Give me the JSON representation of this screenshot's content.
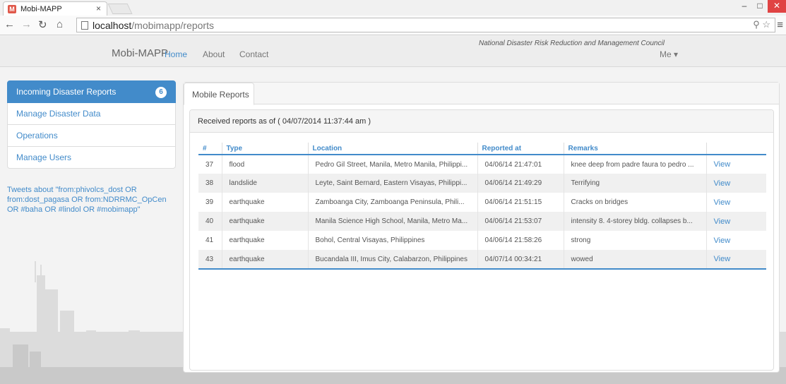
{
  "browser": {
    "tab_title": "Mobi-MAPP",
    "tab_close": "×",
    "url_host": "localhost",
    "url_path": "/mobimapp/reports"
  },
  "navbar": {
    "brand": "Mobi-MAPP",
    "links": [
      "Home",
      "About",
      "Contact"
    ],
    "council": "National Disaster Risk Reduction and Management Council",
    "user_menu": "Me ▾"
  },
  "sidebar": {
    "items": [
      {
        "label": "Incoming Disaster Reports",
        "badge": "6"
      },
      {
        "label": "Manage Disaster Data"
      },
      {
        "label": "Operations"
      },
      {
        "label": "Manage Users"
      }
    ],
    "tweets": "Tweets about \"from:phivolcs_dost OR from:dost_pagasa OR from:NDRRMC_OpCen OR #baha OR #lindol OR #mobimapp\""
  },
  "main": {
    "tab": "Mobile Reports",
    "received": "Received reports as of ( 04/07/2014 11:37:44 am )",
    "columns": [
      "#",
      "Type",
      "Location",
      "Reported at",
      "Remarks",
      ""
    ],
    "rows": [
      {
        "id": "37",
        "type": "flood",
        "location": "Pedro Gil Street, Manila, Metro Manila, Philippi...",
        "reported": "04/06/14 21:47:01",
        "remarks": "knee deep from padre faura to pedro ...",
        "action": "View"
      },
      {
        "id": "38",
        "type": "landslide",
        "location": "Leyte, Saint Bernard, Eastern Visayas, Philippi...",
        "reported": "04/06/14 21:49:29",
        "remarks": "Terrifying",
        "action": "View"
      },
      {
        "id": "39",
        "type": "earthquake",
        "location": "Zamboanga City, Zamboanga Peninsula, Phili...",
        "reported": "04/06/14 21:51:15",
        "remarks": "Cracks on bridges",
        "action": "View"
      },
      {
        "id": "40",
        "type": "earthquake",
        "location": "Manila Science High School, Manila, Metro Ma...",
        "reported": "04/06/14 21:53:07",
        "remarks": "intensity 8. 4-storey bldg. collapses b...",
        "action": "View"
      },
      {
        "id": "41",
        "type": "earthquake",
        "location": "Bohol, Central Visayas, Philippines",
        "reported": "04/06/14 21:58:26",
        "remarks": "strong",
        "action": "View"
      },
      {
        "id": "43",
        "type": "earthquake",
        "location": "Bucandala III, Imus City, Calabarzon, Philippines",
        "reported": "04/07/14 00:34:21",
        "remarks": "wowed",
        "action": "View"
      }
    ]
  },
  "colors": {
    "accent": "#428bca",
    "close": "#e04343"
  }
}
